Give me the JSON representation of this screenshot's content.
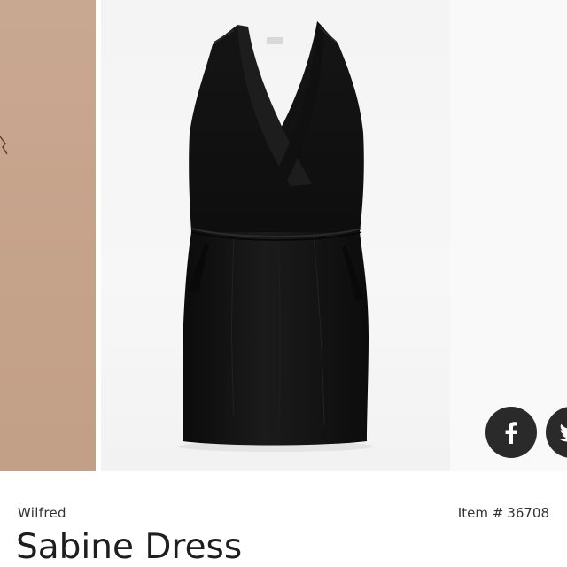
{
  "product": {
    "brand": "Wilfred",
    "item_prefix": "Item #",
    "item_number": "36708",
    "title": "Sabine Dress"
  },
  "share": {
    "facebook_icon": "facebook-icon",
    "twitter_icon": "twitter-icon"
  },
  "colors": {
    "share_button_bg": "#2a2a2a",
    "prev_slide_bg": "#c6a38b",
    "dress": "#141414"
  }
}
